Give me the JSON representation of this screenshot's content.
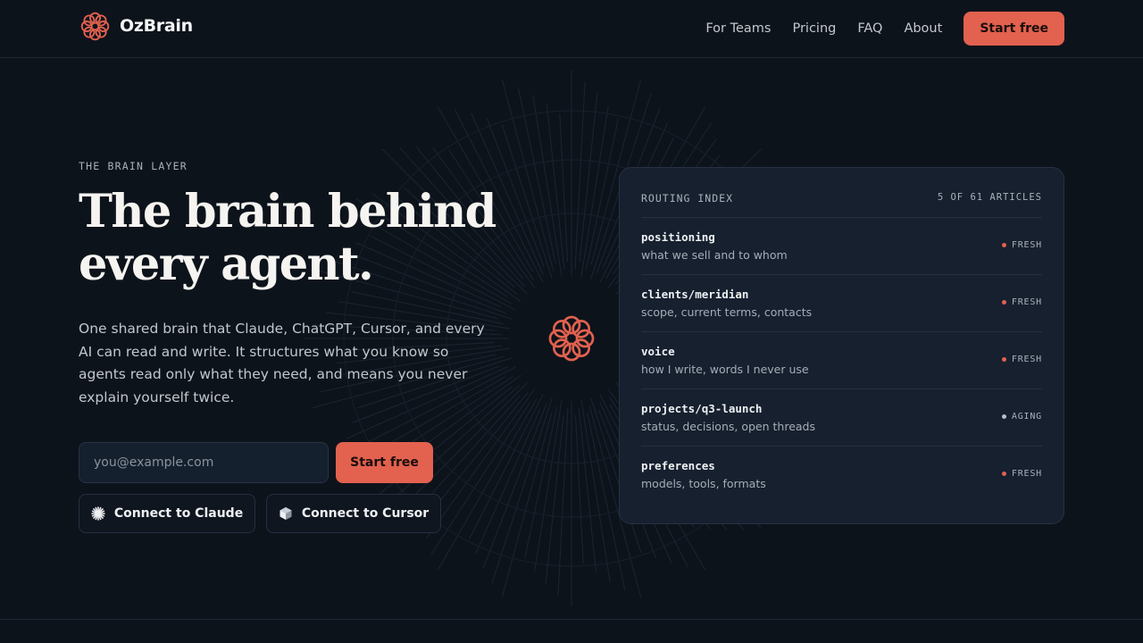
{
  "colors": {
    "accent": "#e2614f",
    "background": "#0d131b",
    "card": "#16202f",
    "fresh": "#e2614f",
    "aging": "#b8bfc6"
  },
  "nav": {
    "brand": "OzBrain",
    "links": [
      "For Teams",
      "Pricing",
      "FAQ",
      "About"
    ],
    "cta": "Start free"
  },
  "hero": {
    "eyebrow": "THE BRAIN LAYER",
    "headline_line1": "The brain behind",
    "headline_line2": "every agent.",
    "lede": "One shared brain that Claude, ChatGPT, Cursor, and every AI can read and write. It structures what you know so agents read only what they need, and means you never explain yourself twice.",
    "email_placeholder": "you@example.com",
    "cta": "Start free",
    "connect_claude": "Connect to Claude",
    "connect_cursor": "Connect to Cursor"
  },
  "routing": {
    "title": "ROUTING INDEX",
    "count": "5 OF 61 ARTICLES",
    "rows": [
      {
        "path": "positioning",
        "desc": "what we sell and to whom",
        "status": "FRESH",
        "status_kind": "fresh"
      },
      {
        "path": "clients/meridian",
        "desc": "scope, current terms, contacts",
        "status": "FRESH",
        "status_kind": "fresh"
      },
      {
        "path": "voice",
        "desc": "how I write, words I never use",
        "status": "FRESH",
        "status_kind": "fresh"
      },
      {
        "path": "projects/q3-launch",
        "desc": "status, decisions, open threads",
        "status": "AGING",
        "status_kind": "aging"
      },
      {
        "path": "preferences",
        "desc": "models, tools, formats",
        "status": "FRESH",
        "status_kind": "fresh"
      }
    ]
  }
}
